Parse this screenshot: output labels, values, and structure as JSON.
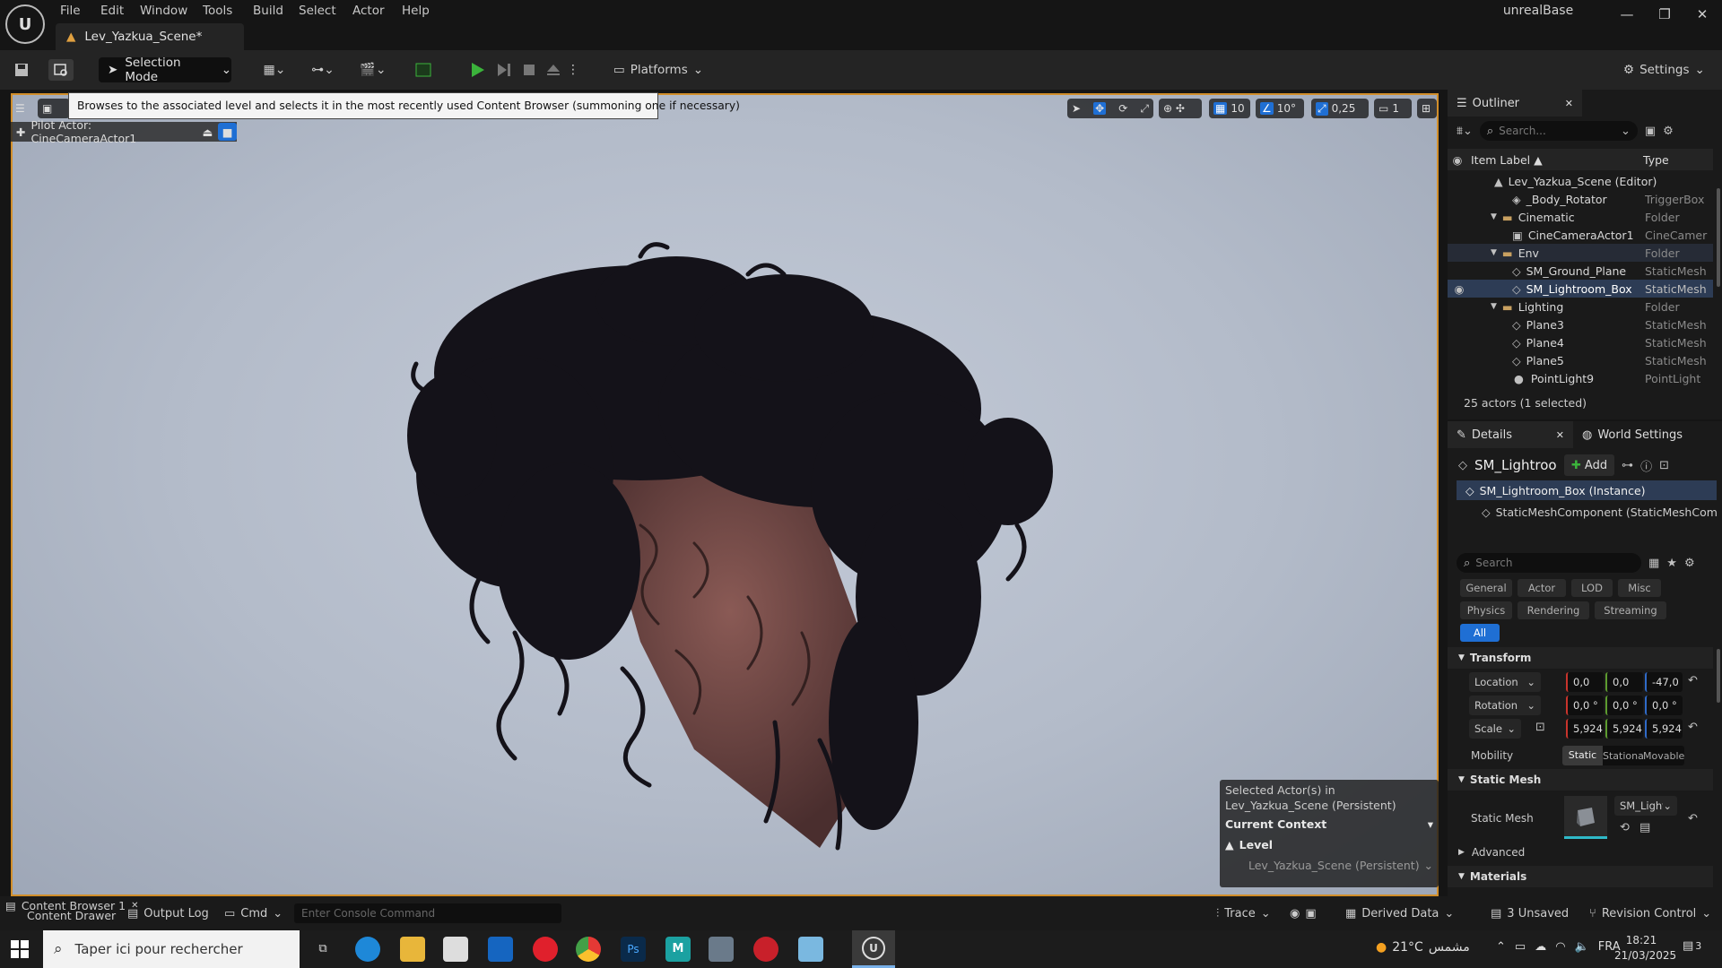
{
  "app": {
    "name": "unrealBase",
    "document_tab": "Lev_Yazkua_Scene*"
  },
  "menu": [
    "File",
    "Edit",
    "Window",
    "Tools",
    "Build",
    "Select",
    "Actor",
    "Help"
  ],
  "toolbar": {
    "selection_mode": "Selection Mode",
    "platforms": "Platforms",
    "settings": "Settings"
  },
  "viewport": {
    "tooltip": "Browses to the associated level and selects it in the most recently used Content Browser (summoning one if necessary)",
    "pilot_label": "Pilot Actor: CineCameraActor1",
    "grid_snap": "10",
    "rotation_snap": "10°",
    "scale_snap": "0,25",
    "camera_speed": "1",
    "context": {
      "selected_line1": "Selected Actor(s) in",
      "selected_line2": "Lev_Yazkua_Scene (Persistent)",
      "current_context": "Current Context",
      "level_label": "Level",
      "level_value": "Lev_Yazkua_Scene (Persistent)"
    }
  },
  "outliner": {
    "title": "Outliner",
    "search_placeholder": "Search...",
    "col_label": "Item Label ▲",
    "col_type": "Type",
    "rows": [
      {
        "label": "Lev_Yazkua_Scene (Editor)",
        "type": ""
      },
      {
        "label": "_Body_Rotator",
        "type": "TriggerBox"
      },
      {
        "label": "Cinematic",
        "type": "Folder"
      },
      {
        "label": "CineCameraActor1",
        "type": "CineCamera"
      },
      {
        "label": "Env",
        "type": "Folder"
      },
      {
        "label": "SM_Ground_Plane",
        "type": "StaticMesh"
      },
      {
        "label": "SM_Lightroom_Box",
        "type": "StaticMesh"
      },
      {
        "label": "Lighting",
        "type": "Folder"
      },
      {
        "label": "Plane3",
        "type": "StaticMesh"
      },
      {
        "label": "Plane4",
        "type": "StaticMesh"
      },
      {
        "label": "Plane5",
        "type": "StaticMesh"
      },
      {
        "label": "PointLight9",
        "type": "PointLight"
      }
    ],
    "footer": "25 actors (1 selected)"
  },
  "details": {
    "tab_details": "Details",
    "tab_world": "World Settings",
    "actor_name": "SM_Lightroom_Box",
    "add_label": "Add",
    "instance": "SM_Lightroom_Box (Instance)",
    "component": "StaticMeshComponent (StaticMeshComponent)",
    "search_placeholder": "Search",
    "categories": [
      "General",
      "Actor",
      "LOD",
      "Misc",
      "Physics",
      "Rendering",
      "Streaming",
      "All"
    ],
    "transform_header": "Transform",
    "location_label": "Location",
    "location": [
      "0,0",
      "0,0",
      "-47,0"
    ],
    "rotation_label": "Rotation",
    "rotation": [
      "0,0 °",
      "0,0 °",
      "0,0 °"
    ],
    "scale_label": "Scale",
    "scale": [
      "5,924",
      "5,924",
      "5,924"
    ],
    "mobility_label": "Mobility",
    "mobility": [
      "Static",
      "Stationary",
      "Movable"
    ],
    "static_mesh_header": "Static Mesh",
    "static_mesh_label": "Static Mesh",
    "static_mesh_value": "SM_Lightroom_Box",
    "advanced": "Advanced",
    "materials": "Materials"
  },
  "statusbar": {
    "content_drawer": "Content Drawer",
    "content_browser_tab": "Content Browser 1",
    "output_log": "Output Log",
    "cmd": "Cmd",
    "console_placeholder": "Enter Console Command",
    "trace": "Trace",
    "derived_data": "Derived Data",
    "unsaved": "3 Unsaved",
    "revision_control": "Revision Control"
  },
  "taskbar": {
    "search_placeholder": "Taper ici pour rechercher",
    "weather": "21°C",
    "weather_text": "مشمس",
    "lang": "FRA",
    "time": "18:21",
    "date": "21/03/2025",
    "notif_count": "3"
  },
  "colors": {
    "accent": "#1f6fd4",
    "viewport_border": "#d18e2a",
    "play": "#3bb33b"
  }
}
